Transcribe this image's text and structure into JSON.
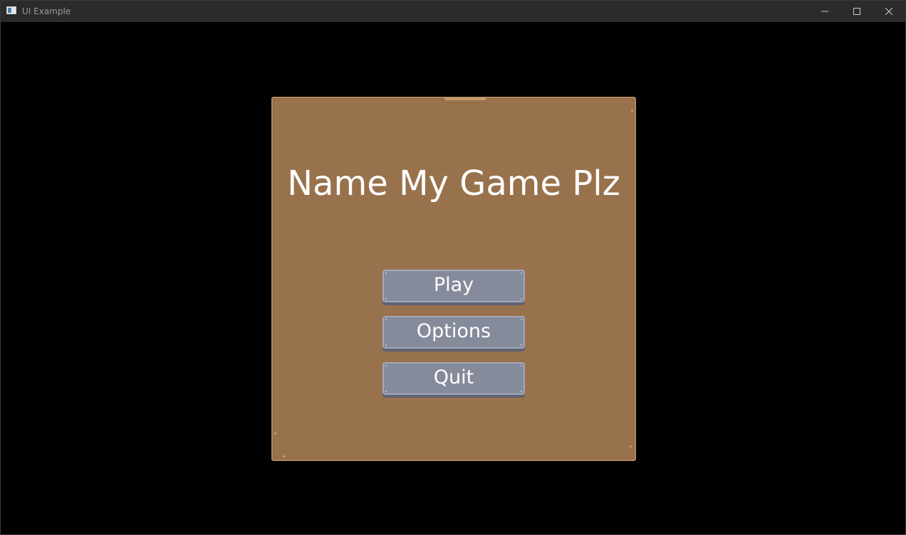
{
  "window": {
    "title": "UI Example",
    "icon": "app-window-icon",
    "controls": {
      "minimize_icon": "minimize-icon",
      "maximize_icon": "maximize-icon",
      "close_icon": "close-icon"
    }
  },
  "menu": {
    "title": "Name My Game Plz",
    "buttons": [
      {
        "label": "Play"
      },
      {
        "label": "Options"
      },
      {
        "label": "Quit"
      }
    ]
  },
  "colors": {
    "background": "#000000",
    "panel": "#98724c",
    "panel_border": "#b48a5e",
    "button": "#868b9b",
    "button_shadow": "#5f6373",
    "text": "#ffffff",
    "titlebar": "#2b2b2b"
  }
}
